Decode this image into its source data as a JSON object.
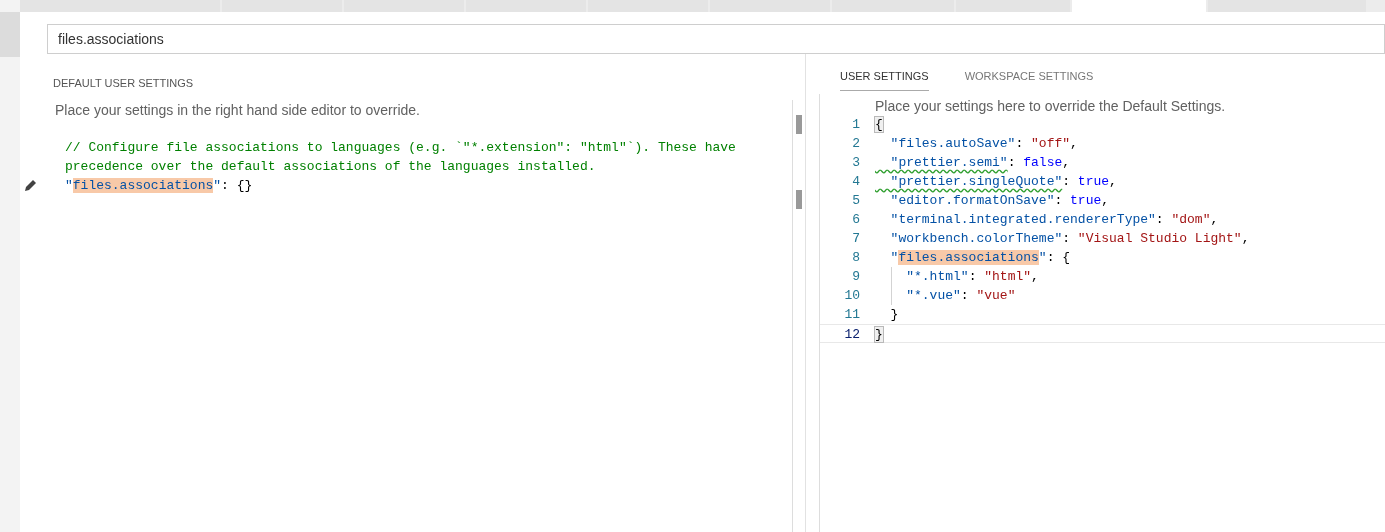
{
  "editor_tabs": [
    {
      "selected": false
    },
    {
      "selected": false
    },
    {
      "selected": false
    },
    {
      "selected": false
    },
    {
      "selected": false
    },
    {
      "selected": false
    },
    {
      "selected": false
    },
    {
      "selected": false
    },
    {
      "selected": true
    },
    {
      "selected": false
    }
  ],
  "search": {
    "value": "files.associations"
  },
  "default_settings": {
    "title": "DEFAULT USER SETTINGS",
    "hint": "Place your settings in the right hand side editor to override.",
    "lines": [
      {
        "edit_icon": false,
        "tokens": [
          {
            "kind": "comment",
            "text": "// Configure file associations to languages (e.g. `\"*.extension\": \"html\"`). These have"
          }
        ]
      },
      {
        "edit_icon": false,
        "tokens": [
          {
            "kind": "comment",
            "text": "precedence over the default associations of the languages installed."
          }
        ]
      },
      {
        "edit_icon": true,
        "tokens": [
          {
            "kind": "key",
            "text": "\""
          },
          {
            "kind": "key",
            "text": "files.associations",
            "match": true
          },
          {
            "kind": "key",
            "text": "\""
          },
          {
            "kind": "punct",
            "text": ": {}"
          }
        ]
      }
    ]
  },
  "user_settings": {
    "tabs": [
      {
        "label": "USER SETTINGS",
        "selected": true
      },
      {
        "label": "WORKSPACE SETTINGS",
        "selected": false
      }
    ],
    "hint": "Place your settings here to override the Default Settings.",
    "lines": [
      {
        "number": "1",
        "current": false,
        "guide": false,
        "tokens": [
          {
            "kind": "punct",
            "text": "{",
            "bracket_match": true
          }
        ]
      },
      {
        "number": "2",
        "current": false,
        "guide": false,
        "tokens": [
          {
            "kind": "key",
            "text": "  \"files.autoSave\""
          },
          {
            "kind": "punct",
            "text": ": "
          },
          {
            "kind": "string",
            "text": "\"off\""
          },
          {
            "kind": "punct",
            "text": ","
          }
        ]
      },
      {
        "number": "3",
        "current": false,
        "guide": false,
        "tokens": [
          {
            "kind": "key",
            "text": "  \"prettier.semi\"",
            "warning": true
          },
          {
            "kind": "punct",
            "text": ": "
          },
          {
            "kind": "keyword",
            "text": "false"
          },
          {
            "kind": "punct",
            "text": ","
          }
        ]
      },
      {
        "number": "4",
        "current": false,
        "guide": false,
        "tokens": [
          {
            "kind": "key",
            "text": "  \"prettier.singleQuote\"",
            "warning": true
          },
          {
            "kind": "punct",
            "text": ": "
          },
          {
            "kind": "keyword",
            "text": "true"
          },
          {
            "kind": "punct",
            "text": ","
          }
        ]
      },
      {
        "number": "5",
        "current": false,
        "guide": false,
        "tokens": [
          {
            "kind": "key",
            "text": "  \"editor.formatOnSave\""
          },
          {
            "kind": "punct",
            "text": ": "
          },
          {
            "kind": "keyword",
            "text": "true"
          },
          {
            "kind": "punct",
            "text": ","
          }
        ]
      },
      {
        "number": "6",
        "current": false,
        "guide": false,
        "tokens": [
          {
            "kind": "key",
            "text": "  \"terminal.integrated.rendererType\""
          },
          {
            "kind": "punct",
            "text": ": "
          },
          {
            "kind": "string",
            "text": "\"dom\""
          },
          {
            "kind": "punct",
            "text": ","
          }
        ]
      },
      {
        "number": "7",
        "current": false,
        "guide": false,
        "tokens": [
          {
            "kind": "key",
            "text": "  \"workbench.colorTheme\""
          },
          {
            "kind": "punct",
            "text": ": "
          },
          {
            "kind": "string",
            "text": "\"Visual Studio Light\""
          },
          {
            "kind": "punct",
            "text": ","
          }
        ]
      },
      {
        "number": "8",
        "current": false,
        "guide": false,
        "tokens": [
          {
            "kind": "key",
            "text": "  \""
          },
          {
            "kind": "key",
            "text": "files.associations",
            "match": true
          },
          {
            "kind": "key",
            "text": "\""
          },
          {
            "kind": "punct",
            "text": ": {"
          }
        ]
      },
      {
        "number": "9",
        "current": false,
        "guide": true,
        "tokens": [
          {
            "kind": "key",
            "text": "    \"*.html\""
          },
          {
            "kind": "punct",
            "text": ": "
          },
          {
            "kind": "string",
            "text": "\"html\""
          },
          {
            "kind": "punct",
            "text": ","
          }
        ]
      },
      {
        "number": "10",
        "current": false,
        "guide": true,
        "tokens": [
          {
            "kind": "key",
            "text": "    \"*.vue\""
          },
          {
            "kind": "punct",
            "text": ": "
          },
          {
            "kind": "string",
            "text": "\"vue\""
          }
        ]
      },
      {
        "number": "11",
        "current": false,
        "guide": false,
        "tokens": [
          {
            "kind": "punct",
            "text": "  }"
          }
        ]
      },
      {
        "number": "12",
        "current": true,
        "guide": false,
        "tokens": [
          {
            "kind": "punct",
            "text": "}",
            "bracket_match": true
          }
        ]
      }
    ]
  }
}
